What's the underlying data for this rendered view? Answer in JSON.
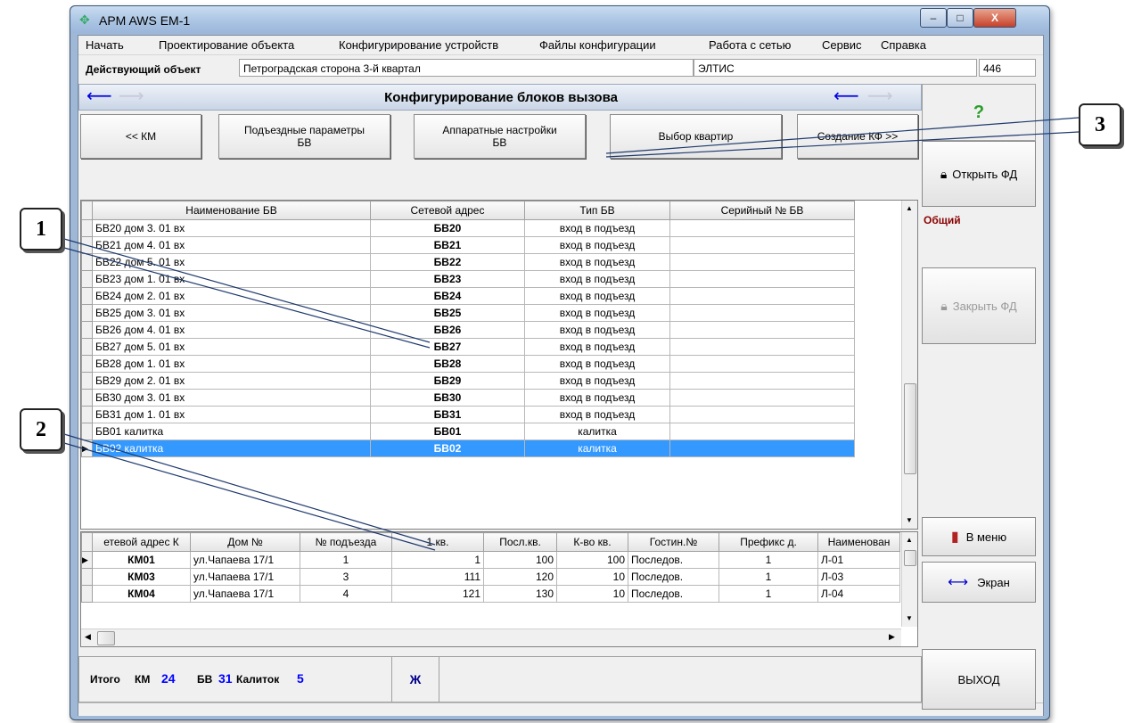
{
  "window": {
    "title": "APM AWS EM-1",
    "min_label": "–",
    "max_label": "□",
    "close_label": "X"
  },
  "menu": [
    "Начать",
    "Проектирование объекта",
    "Конфигурирование устройств",
    "Файлы конфигурации",
    "Работа с сетью",
    "Сервис",
    "Справка"
  ],
  "object_row": {
    "label": "Действующий объект",
    "name": "Петроградская сторона 3-й квартал",
    "company": "ЭЛТИС",
    "number": "446"
  },
  "header": {
    "title": "Конфигурирование блоков вызова"
  },
  "nav_buttons": [
    "<< КМ",
    "Подъездные параметры\nБВ",
    "Аппаратные  настройки\nБВ",
    "Выбор квартир",
    "Создание КФ >>"
  ],
  "bv_table": {
    "columns": [
      "Наименование БВ",
      "Сетевой адрес",
      "Тип БВ",
      "Серийный № БВ"
    ],
    "rows": [
      [
        "БВ20 дом  3. 01 вх",
        "БВ20",
        "вход в подъезд",
        ""
      ],
      [
        "БВ21 дом  4. 01 вх",
        "БВ21",
        "вход в подъезд",
        ""
      ],
      [
        "БВ22 дом  5. 01 вх",
        "БВ22",
        "вход в подъезд",
        ""
      ],
      [
        "БВ23 дом  1. 01 вх",
        "БВ23",
        "вход в подъезд",
        ""
      ],
      [
        "БВ24 дом  2. 01 вх",
        "БВ24",
        "вход в подъезд",
        ""
      ],
      [
        "БВ25 дом  3. 01 вх",
        "БВ25",
        "вход в подъезд",
        ""
      ],
      [
        "БВ26 дом  4. 01 вх",
        "БВ26",
        "вход в подъезд",
        ""
      ],
      [
        "БВ27 дом  5. 01 вх",
        "БВ27",
        "вход в подъезд",
        ""
      ],
      [
        "БВ28 дом  1. 01 вх",
        "БВ28",
        "вход в подъезд",
        ""
      ],
      [
        "БВ29 дом  2. 01 вх",
        "БВ29",
        "вход в подъезд",
        ""
      ],
      [
        "БВ30 дом  3. 01 вх",
        "БВ30",
        "вход в подъезд",
        ""
      ],
      [
        "БВ31 дом  1. 01 вх",
        "БВ31",
        "вход в подъезд",
        ""
      ],
      [
        "БВ01 калитка",
        "БВ01",
        "калитка",
        ""
      ],
      [
        "БВ02 калитка",
        "БВ02",
        "калитка",
        ""
      ]
    ],
    "selected_index": 13
  },
  "km_table": {
    "columns": [
      "етевой адрес К",
      "Дом №",
      "№ подъезда",
      "1 кв.",
      "Посл.кв.",
      "К-во кв.",
      "Гостин.№",
      "Префикс д.",
      "Наименован"
    ],
    "rows": [
      [
        "КМ01",
        "ул.Чапаева 17/1",
        "1",
        "1",
        "100",
        "100",
        "Последов.",
        "1",
        "Л-01"
      ],
      [
        "КМ03",
        "ул.Чапаева 17/1",
        "3",
        "111",
        "120",
        "10",
        "Последов.",
        "1",
        "Л-03"
      ],
      [
        "КМ04",
        "ул.Чапаева 17/1",
        "4",
        "121",
        "130",
        "10",
        "Последов.",
        "1",
        "Л-04"
      ]
    ]
  },
  "right_panel": {
    "help": "?",
    "open_fd": "Открыть ФД",
    "general": "Общий",
    "close_fd": "Закрыть ФД",
    "to_menu": "В меню",
    "screen": "Экран",
    "exit": "ВЫХОД"
  },
  "totals": {
    "label": "Итого",
    "km_label": "КМ",
    "km_value": "24",
    "bv_label": "БВ",
    "bv_value": "31",
    "gates_label": "Калиток",
    "gates_value": "5",
    "bold_btn": "Ж"
  },
  "callouts": [
    "1",
    "2",
    "3"
  ],
  "colors": {
    "selection": "#3399ff",
    "accent_blue": "#0000ff",
    "general_label": "#8b0000"
  }
}
